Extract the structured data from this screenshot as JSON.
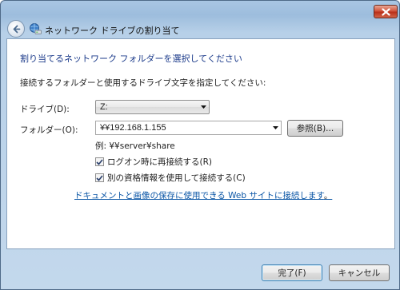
{
  "window": {
    "title": "ネットワーク ドライブの割り当て",
    "accent": "#1b3a8a",
    "link_color": "#0b56a6"
  },
  "icons": {
    "close": "close-icon",
    "back": "back-arrow-icon",
    "title": "network-drive-icon",
    "dropdown": "chevron-down-icon",
    "check": "checkmark-icon"
  },
  "main": {
    "heading": "割り当てるネットワーク フォルダーを選択してください",
    "instruction": "接続するフォルダーと使用するドライブ文字を指定してください:",
    "drive_label": "ドライブ(D):",
    "drive_value": "Z:",
    "folder_label": "フォルダー(O):",
    "folder_value": "¥¥192.168.1.155",
    "browse_label": "参照(B)...",
    "example_text": "例: ¥¥server¥share",
    "reconnect_label": "ログオン時に再接続する(R)",
    "reconnect_checked": true,
    "credentials_label": "別の資格情報を使用して接続する(C)",
    "credentials_checked": true,
    "link_text": "ドキュメントと画像の保存に使用できる Web サイトに接続します",
    "link_suffix": "。"
  },
  "footer": {
    "finish_label": "完了(F)",
    "cancel_label": "キャンセル"
  }
}
